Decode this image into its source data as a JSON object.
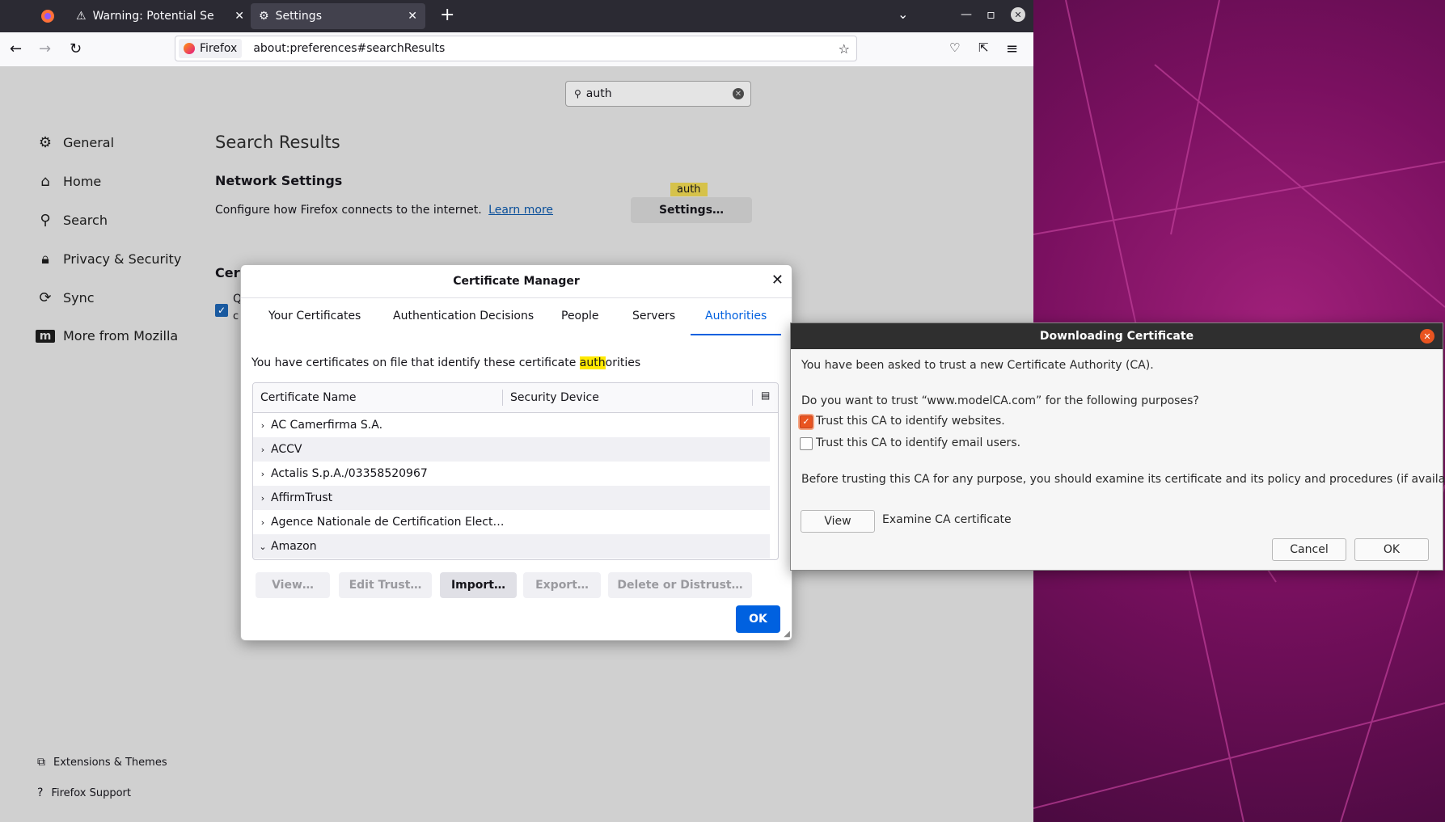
{
  "browser": {
    "tabs": [
      {
        "label": "Warning: Potential Security Risk Ahead",
        "icon": "warning-icon"
      },
      {
        "label": "Settings",
        "icon": "gear-icon"
      }
    ],
    "url": {
      "identity": "Firefox",
      "address": "about:preferences#searchResults"
    }
  },
  "prefs": {
    "search_value": "auth",
    "sidebar": [
      {
        "label": "General",
        "icon": "gear-icon"
      },
      {
        "label": "Home",
        "icon": "home-icon"
      },
      {
        "label": "Search",
        "icon": "search-icon"
      },
      {
        "label": "Privacy & Security",
        "icon": "lock-icon"
      },
      {
        "label": "Sync",
        "icon": "sync-icon"
      },
      {
        "label": "More from Mozilla",
        "icon": "mozilla-icon"
      }
    ],
    "footer": [
      {
        "label": "Extensions & Themes",
        "icon": "puzzle-icon"
      },
      {
        "label": "Firefox Support",
        "icon": "help-icon"
      }
    ],
    "results_title": "Search Results",
    "network": {
      "title": "Network Settings",
      "description": "Configure how Firefox connects to the internet.",
      "learn_more": "Learn more",
      "settings_button": "Settings…",
      "tooltip": "auth"
    },
    "cert_heading": "Cert",
    "cert_item_text_1": "Q",
    "cert_item_text_2": "c"
  },
  "cert_manager": {
    "title": "Certificate Manager",
    "tabs": [
      "Your Certificates",
      "Authentication Decisions",
      "People",
      "Servers",
      "Authorities"
    ],
    "active_tab": "Authorities",
    "description_pre": "You have certificates on file that identify these certificate ",
    "description_highlight": "auth",
    "description_post": "orities",
    "columns": [
      "Certificate Name",
      "Security Device"
    ],
    "rows": [
      {
        "name": "AC Camerfirma S.A.",
        "expanded": false
      },
      {
        "name": "ACCV",
        "expanded": false
      },
      {
        "name": "Actalis S.p.A./03358520967",
        "expanded": false
      },
      {
        "name": "AffirmTrust",
        "expanded": false
      },
      {
        "name": "Agence Nationale de Certification Elect…",
        "expanded": false
      },
      {
        "name": "Amazon",
        "expanded": true
      }
    ],
    "buttons": [
      "View…",
      "Edit Trust…",
      "Import…",
      "Export…",
      "Delete or Distrust…"
    ],
    "ok": "OK"
  },
  "download_dialog": {
    "title": "Downloading Certificate",
    "intro": "You have been asked to trust a new Certificate Authority (CA).",
    "question": "Do you want to trust “www.modelCA.com” for the following purposes?",
    "trust_websites": "Trust this CA to identify websites.",
    "trust_websites_checked": true,
    "trust_email": "Trust this CA to identify email users.",
    "trust_email_checked": false,
    "warning": "Before trusting this CA for any purpose, you should examine its certificate and its policy and procedures (if available).",
    "view_button": "View",
    "examine_label": "Examine CA certificate",
    "cancel": "Cancel",
    "ok": "OK"
  },
  "colors": {
    "accent": "#0060df",
    "ubuntu_orange": "#e95420",
    "tabbar": "#2b2a33",
    "highlight": "#ffe900"
  }
}
